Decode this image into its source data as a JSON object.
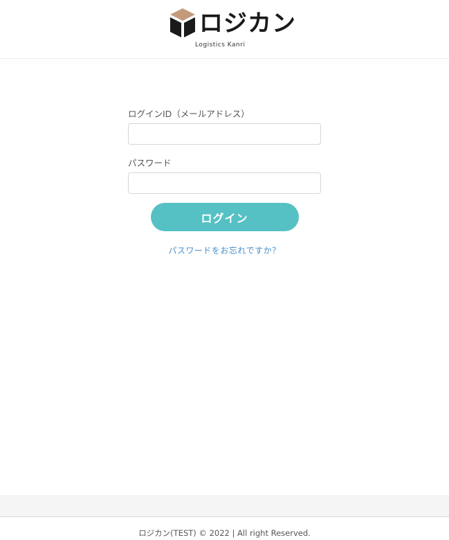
{
  "brand": {
    "name": "ロジカン",
    "subtitle": "Logistics Kanri",
    "colors": {
      "cube_top": "#c49a7c",
      "cube_body": "#1a1a1a",
      "accent": "#55c1c4",
      "link": "#4a8ec9"
    }
  },
  "login": {
    "id_label": "ログインID（メールアドレス）",
    "id_value": "",
    "password_label": "パスワード",
    "password_value": "",
    "submit_label": "ログイン",
    "forgot_link": "パスワードをお忘れですか？"
  },
  "footer": {
    "copyright": "ロジカン(TEST) © 2022 | All right Reserved."
  }
}
